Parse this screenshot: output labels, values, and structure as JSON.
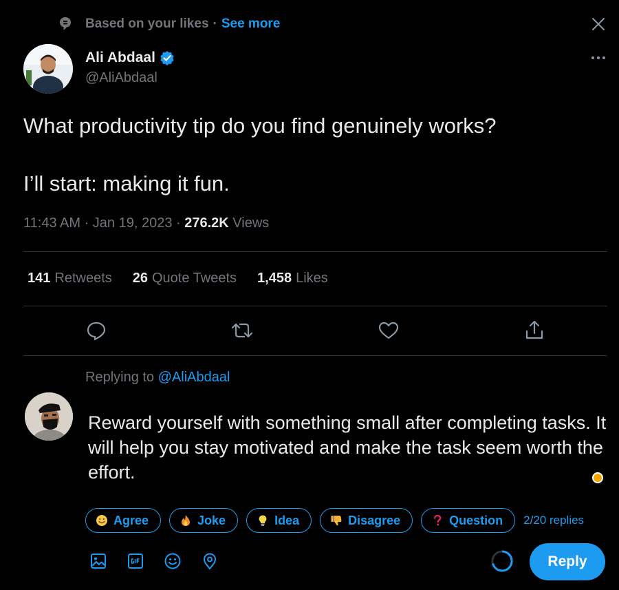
{
  "context": {
    "label": "Based on your likes",
    "separator": "·",
    "link": "See more"
  },
  "author": {
    "name": "Ali Abdaal",
    "handle": "@AliAbdaal"
  },
  "tweet": {
    "line1": "What productivity tip do you find genuinely works?",
    "line2": "I’ll start: making it fun.",
    "time": "11:43 AM · Jan 19, 2023 · ",
    "views_count": "276.2K",
    "views_label": " Views"
  },
  "stats": [
    {
      "count": "141",
      "label": "Retweets"
    },
    {
      "count": "26",
      "label": "Quote Tweets"
    },
    {
      "count": "1,458",
      "label": "Likes"
    }
  ],
  "reply": {
    "replying_prefix": "Replying to ",
    "replying_handle": "@AliAbdaal",
    "text": "Reward yourself with something small after completing tasks. It will help you stay motivated and make the task seem worth the effort."
  },
  "chips": [
    {
      "label": "Agree",
      "icon": "smile-emoji-icon",
      "color": "#f7c948"
    },
    {
      "label": "Joke",
      "icon": "fire-emoji-icon",
      "color": "#f28a2e"
    },
    {
      "label": "Idea",
      "icon": "lightbulb-emoji-icon",
      "color": "#f7d64a"
    },
    {
      "label": "Disagree",
      "icon": "thumbs-down-emoji-icon",
      "color": "#f2b33a"
    },
    {
      "label": "Question",
      "icon": "question-emoji-icon",
      "color": "#e0245e"
    }
  ],
  "chip_count": "2/20 replies",
  "reply_button": "Reply",
  "colors": {
    "accent": "#1d9bf0",
    "background": "#000000",
    "muted": "#71767b",
    "divider": "#2f3336"
  }
}
